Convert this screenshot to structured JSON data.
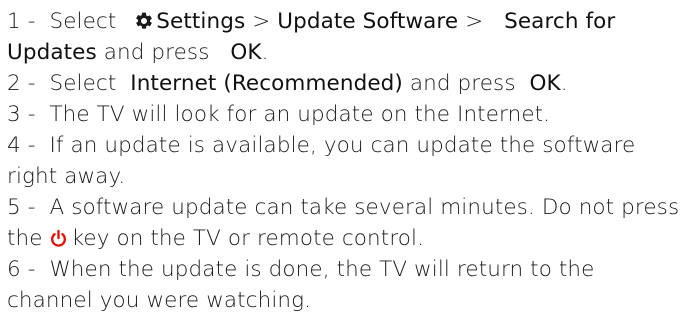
{
  "steps": [
    {
      "num": "1 -",
      "t1": "Select",
      "ui1": "Settings",
      "sep1": ">",
      "ui2": "Update Software",
      "sep2": ">",
      "ui3": "Search for Updates",
      "t2": "and press",
      "ui4": "OK",
      "t3": "."
    },
    {
      "num": "2 -",
      "t1": "Select",
      "ui1": "Internet (Recommended)",
      "t2": "and press",
      "ui2": "OK",
      "t3": "."
    },
    {
      "num": "3 -",
      "text": "The TV will look for an update on the Internet."
    },
    {
      "num": "4 -",
      "text": "If an update is available, you can update the software right away."
    },
    {
      "num": "5 -",
      "t1": "A software update can take several minutes. Do not press the",
      "t2": "key on the TV or remote control."
    },
    {
      "num": "6 -",
      "text": "When the update is done, the TV will return to the channel you were watching."
    }
  ],
  "icons": {
    "settings": "gear-icon",
    "power": "power-icon",
    "power_color": "#e3120b"
  }
}
